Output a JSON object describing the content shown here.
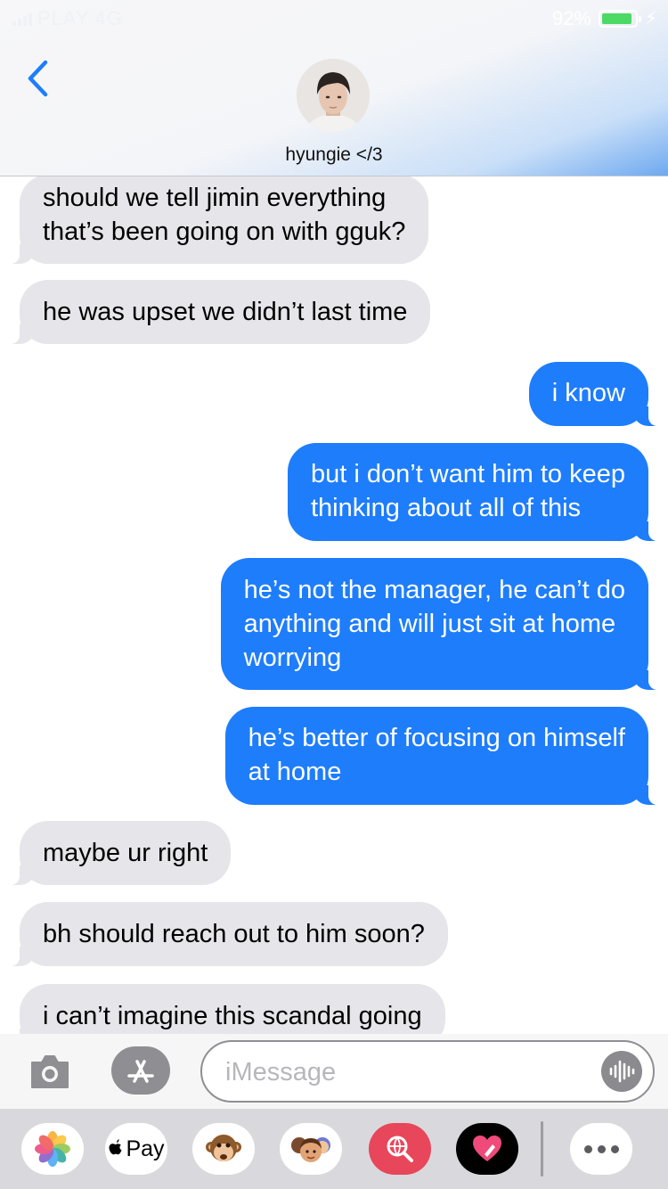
{
  "status_bar": {
    "carrier": "PLAY",
    "network": "4G",
    "battery_percent": "92%",
    "battery_level": 0.92
  },
  "header": {
    "contact_name": "hyungie </3",
    "back_icon": "chevron-left-icon"
  },
  "messages": [
    {
      "direction": "incoming",
      "lines": [
        "should we tell jimin everything",
        "that’s been going on with gguk?"
      ]
    },
    {
      "direction": "incoming",
      "lines": [
        "he was upset we didn’t last time"
      ]
    },
    {
      "direction": "outgoing",
      "lines": [
        "i know"
      ]
    },
    {
      "direction": "outgoing",
      "lines": [
        "but i don’t want him to keep",
        "thinking about all of this"
      ]
    },
    {
      "direction": "outgoing",
      "lines": [
        "he’s not the manager, he can’t do",
        "anything and will just sit at home",
        "worrying"
      ]
    },
    {
      "direction": "outgoing",
      "lines": [
        "he’s better of focusing on himself",
        "at home"
      ]
    },
    {
      "direction": "incoming",
      "lines": [
        "maybe ur right"
      ]
    },
    {
      "direction": "incoming",
      "lines": [
        "bh should reach out to him soon?"
      ]
    },
    {
      "direction": "incoming",
      "lines": [
        "i can’t imagine this scandal going"
      ]
    }
  ],
  "input_bar": {
    "camera_icon": "camera-icon",
    "appstore_icon": "app-store-icon",
    "placeholder": "iMessage",
    "value": "",
    "audio_icon": "audio-waveform-icon"
  },
  "app_drawer": {
    "apps": [
      "photos-icon",
      "apple-pay-button",
      "monkey-animoji-icon",
      "memoji-stickers-icon",
      "web-search-icon",
      "digital-touch-icon"
    ],
    "apple_pay_label": "Pay",
    "more_icon": "more-ellipsis-icon"
  },
  "colors": {
    "outgoing_bubble": "#1e7dfb",
    "incoming_bubble": "#e5e5ea",
    "battery_fill": "#4cd964",
    "accent": "#1e7dfb"
  }
}
